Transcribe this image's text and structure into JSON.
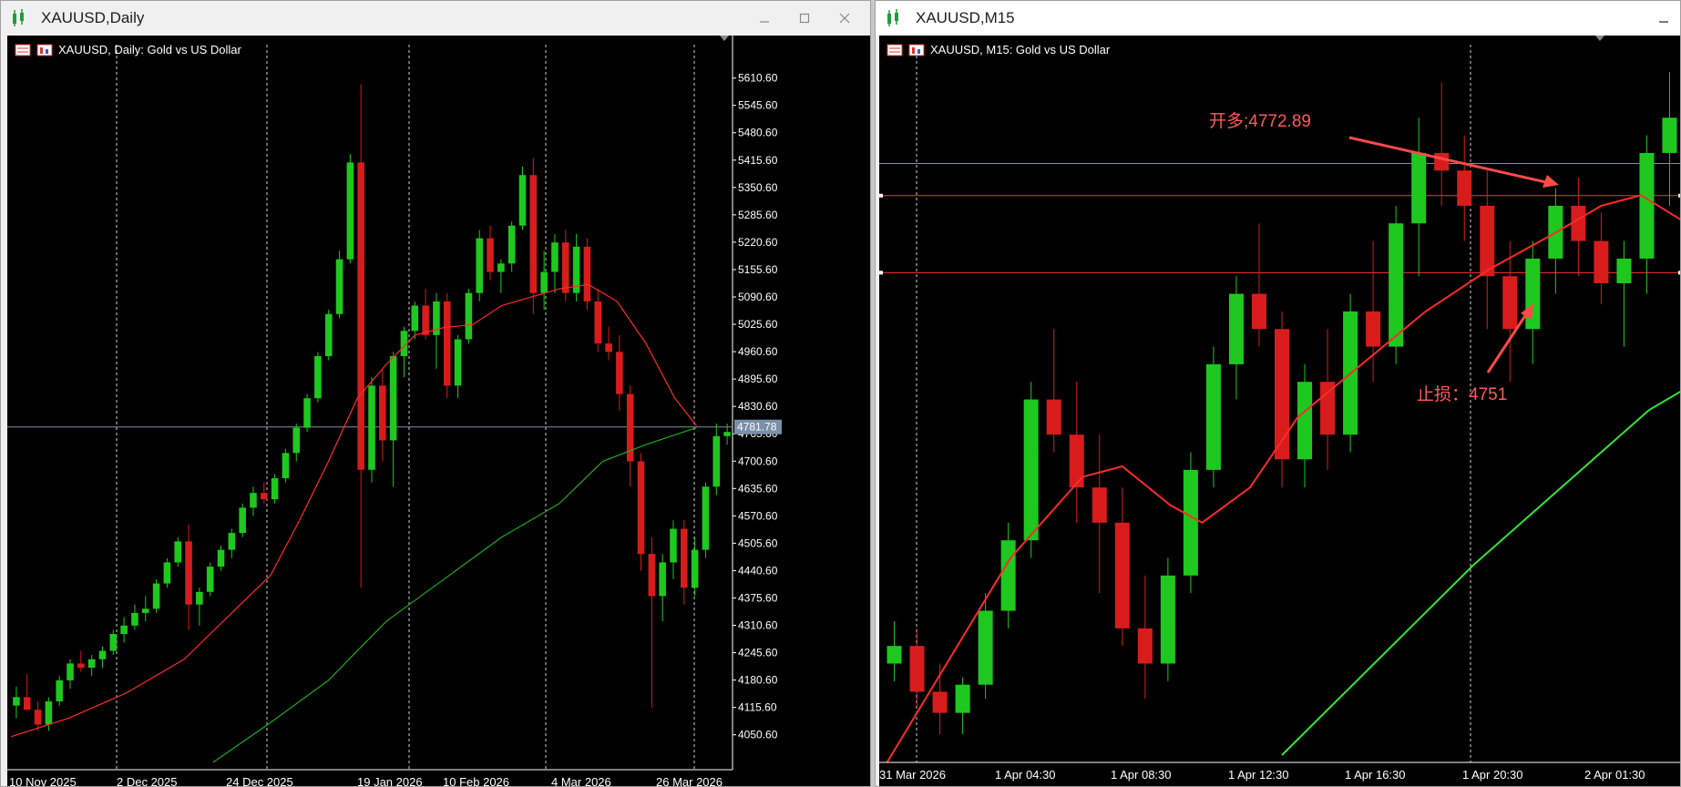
{
  "windows": [
    {
      "id": "daily",
      "title": "XAUUSD,Daily",
      "chart_header": "XAUUSD, Daily:  Gold vs US Dollar",
      "controls": [
        "minimize",
        "maximize",
        "close"
      ],
      "chart_data": {
        "type": "candlestick",
        "symbol": "XAUUSD",
        "timeframe": "Daily",
        "y_ticks": [
          "5610.60",
          "5545.60",
          "5480.60",
          "5415.60",
          "5350.60",
          "5285.60",
          "5220.60",
          "5155.60",
          "5090.60",
          "5025.60",
          "4960.60",
          "4895.60",
          "4830.60",
          "4765.60",
          "4700.60",
          "4635.60",
          "4570.60",
          "4505.60",
          "4440.60",
          "4375.60",
          "4310.60",
          "4245.60",
          "4180.60",
          "4115.60",
          "4050.60"
        ],
        "x_ticks": [
          "10 Nov 2025",
          "2 Dec 2025",
          "24 Dec 2025",
          "19 Jan 2026",
          "10 Feb 2026",
          "4 Mar 2026",
          "26 Mar 2026"
        ],
        "current_price": "4781.78",
        "ylim": [
          3985,
          5625
        ],
        "indicators": [
          {
            "name": "fast MA",
            "color": "#ff2a2a",
            "points": [
              [
                0,
                4046
              ],
              [
                8,
                4090
              ],
              [
                16,
                4150
              ],
              [
                24,
                4230
              ],
              [
                30,
                4330
              ],
              [
                36,
                4430
              ],
              [
                40,
                4560
              ],
              [
                44,
                4700
              ],
              [
                48,
                4850
              ],
              [
                52,
                4930
              ],
              [
                56,
                5000
              ],
              [
                60,
                5018
              ],
              [
                64,
                5025
              ],
              [
                68,
                5070
              ],
              [
                72,
                5090
              ],
              [
                76,
                5110
              ],
              [
                80,
                5120
              ],
              [
                84,
                5080
              ],
              [
                88,
                4980
              ],
              [
                92,
                4850
              ],
              [
                95,
                4785
              ]
            ]
          },
          {
            "name": "slow MA",
            "color": "#1eaa1e",
            "points": [
              [
                28,
                3985
              ],
              [
                36,
                4080
              ],
              [
                44,
                4180
              ],
              [
                52,
                4320
              ],
              [
                60,
                4420
              ],
              [
                68,
                4520
              ],
              [
                76,
                4600
              ],
              [
                82,
                4700
              ],
              [
                88,
                4740
              ],
              [
                95,
                4780
              ]
            ]
          }
        ],
        "candles": [
          [
            4120,
            4165,
            4090,
            4140
          ],
          [
            4140,
            4195,
            4110,
            4110
          ],
          [
            4110,
            4130,
            4060,
            4075
          ],
          [
            4075,
            4140,
            4060,
            4130
          ],
          [
            4130,
            4190,
            4120,
            4180
          ],
          [
            4180,
            4230,
            4160,
            4220
          ],
          [
            4220,
            4250,
            4200,
            4210
          ],
          [
            4210,
            4240,
            4190,
            4230
          ],
          [
            4230,
            4260,
            4210,
            4250
          ],
          [
            4250,
            4300,
            4240,
            4290
          ],
          [
            4290,
            4330,
            4270,
            4310
          ],
          [
            4310,
            4360,
            4300,
            4340
          ],
          [
            4340,
            4380,
            4320,
            4350
          ],
          [
            4350,
            4420,
            4340,
            4410
          ],
          [
            4410,
            4470,
            4400,
            4460
          ],
          [
            4460,
            4520,
            4450,
            4510
          ],
          [
            4510,
            4550,
            4300,
            4360
          ],
          [
            4360,
            4400,
            4310,
            4390
          ],
          [
            4390,
            4460,
            4380,
            4450
          ],
          [
            4450,
            4500,
            4440,
            4490
          ],
          [
            4490,
            4540,
            4470,
            4530
          ],
          [
            4530,
            4600,
            4520,
            4590
          ],
          [
            4590,
            4640,
            4570,
            4625
          ],
          [
            4625,
            4650,
            4600,
            4610
          ],
          [
            4610,
            4670,
            4600,
            4660
          ],
          [
            4660,
            4730,
            4650,
            4720
          ],
          [
            4720,
            4790,
            4700,
            4780
          ],
          [
            4780,
            4860,
            4770,
            4850
          ],
          [
            4850,
            4960,
            4840,
            4950
          ],
          [
            4950,
            5060,
            4940,
            5050
          ],
          [
            5050,
            5200,
            5040,
            5180
          ],
          [
            5180,
            5430,
            5170,
            5410
          ],
          [
            5410,
            5595,
            4400,
            4680
          ],
          [
            4680,
            4900,
            4650,
            4880
          ],
          [
            4880,
            4920,
            4700,
            4750
          ],
          [
            4750,
            4960,
            4640,
            4950
          ],
          [
            4950,
            5020,
            4900,
            5010
          ],
          [
            5010,
            5080,
            4990,
            5070
          ],
          [
            5070,
            5110,
            4990,
            5000
          ],
          [
            5000,
            5100,
            4920,
            5080
          ],
          [
            5080,
            5100,
            4850,
            4880
          ],
          [
            4880,
            5000,
            4850,
            4990
          ],
          [
            4990,
            5110,
            4980,
            5100
          ],
          [
            5100,
            5250,
            5080,
            5230
          ],
          [
            5230,
            5260,
            5130,
            5150
          ],
          [
            5150,
            5180,
            5100,
            5170
          ],
          [
            5170,
            5270,
            5150,
            5260
          ],
          [
            5260,
            5400,
            5250,
            5380
          ],
          [
            5380,
            5420,
            5050,
            5100
          ],
          [
            5100,
            5200,
            5060,
            5150
          ],
          [
            5150,
            5240,
            5100,
            5220
          ],
          [
            5220,
            5250,
            5080,
            5100
          ],
          [
            5100,
            5240,
            5080,
            5210
          ],
          [
            5210,
            5230,
            5060,
            5080
          ],
          [
            5080,
            5110,
            4960,
            4980
          ],
          [
            4980,
            5020,
            4940,
            4960
          ],
          [
            4960,
            5000,
            4820,
            4860
          ],
          [
            4860,
            4880,
            4640,
            4700
          ],
          [
            4700,
            4720,
            4440,
            4480
          ],
          [
            4480,
            4520,
            4115,
            4380
          ],
          [
            4380,
            4480,
            4320,
            4460
          ],
          [
            4460,
            4560,
            4420,
            4540
          ],
          [
            4540,
            4560,
            4360,
            4400
          ],
          [
            4400,
            4520,
            4380,
            4490
          ],
          [
            4490,
            4650,
            4470,
            4640
          ],
          [
            4640,
            4790,
            4620,
            4760
          ],
          [
            4760,
            4790,
            4740,
            4770
          ]
        ]
      }
    },
    {
      "id": "m15",
      "title": "XAUUSD,M15",
      "chart_header": "XAUUSD, M15:  Gold vs US Dollar",
      "controls": [
        "minimize"
      ],
      "chart_data": {
        "type": "candlestick",
        "symbol": "XAUUSD",
        "timeframe": "M15",
        "x_ticks": [
          "31 Mar 2026",
          "1 Apr 04:30",
          "1 Apr 08:30",
          "1 Apr 12:30",
          "1 Apr 16:30",
          "1 Apr 20:30",
          "2 Apr 01:30"
        ],
        "ylim": [
          4614,
          4808
        ],
        "horizontal_lines": [
          {
            "name": "entry-line",
            "price": 4772.89,
            "color": "#ff3030"
          },
          {
            "name": "stop-line",
            "price": 4751,
            "color": "#ff3030"
          },
          {
            "name": "current-price-line",
            "price": 4782,
            "color": "#7a8fa8"
          }
        ],
        "annotations": [
          {
            "name": "entry-annotation",
            "text": "开多;4772.89",
            "color": "#ff5a5a"
          },
          {
            "name": "stop-annotation",
            "text": "止损：4751",
            "color": "#ff5a5a"
          }
        ],
        "indicators": [
          {
            "name": "fast MA",
            "color": "#ff2a2a",
            "points": [
              [
                0,
                4610
              ],
              [
                8,
                4640
              ],
              [
                16,
                4670
              ],
              [
                25,
                4693
              ],
              [
                30,
                4696
              ],
              [
                36,
                4685
              ],
              [
                40,
                4680
              ],
              [
                46,
                4690
              ],
              [
                52,
                4710
              ],
              [
                60,
                4725
              ],
              [
                68,
                4740
              ],
              [
                76,
                4752
              ],
              [
                84,
                4762
              ],
              [
                90,
                4770
              ],
              [
                95,
                4773
              ],
              [
                100,
                4766
              ],
              [
                106,
                4770
              ]
            ]
          },
          {
            "name": "slow MA",
            "color": "#33e633",
            "points": [
              [
                50,
                4614
              ],
              [
                58,
                4632
              ],
              [
                66,
                4650
              ],
              [
                74,
                4668
              ],
              [
                82,
                4684
              ],
              [
                90,
                4700
              ],
              [
                96,
                4712
              ],
              [
                102,
                4720
              ],
              [
                106,
                4728
              ]
            ]
          }
        ],
        "candles": [
          [
            4640,
            4652,
            4635,
            4645
          ],
          [
            4645,
            4650,
            4628,
            4632
          ],
          [
            4632,
            4640,
            4620,
            4626
          ],
          [
            4626,
            4636,
            4620,
            4634
          ],
          [
            4634,
            4660,
            4630,
            4655
          ],
          [
            4655,
            4680,
            4650,
            4675
          ],
          [
            4675,
            4720,
            4670,
            4715
          ],
          [
            4715,
            4735,
            4700,
            4705
          ],
          [
            4705,
            4720,
            4680,
            4690
          ],
          [
            4690,
            4705,
            4660,
            4680
          ],
          [
            4680,
            4690,
            4645,
            4650
          ],
          [
            4650,
            4665,
            4630,
            4640
          ],
          [
            4640,
            4670,
            4635,
            4665
          ],
          [
            4665,
            4700,
            4660,
            4695
          ],
          [
            4695,
            4730,
            4690,
            4725
          ],
          [
            4725,
            4750,
            4715,
            4745
          ],
          [
            4745,
            4765,
            4730,
            4735
          ],
          [
            4735,
            4740,
            4690,
            4698
          ],
          [
            4698,
            4725,
            4690,
            4720
          ],
          [
            4720,
            4735,
            4695,
            4705
          ],
          [
            4705,
            4745,
            4700,
            4740
          ],
          [
            4740,
            4760,
            4720,
            4730
          ],
          [
            4730,
            4770,
            4725,
            4765
          ],
          [
            4765,
            4795,
            4750,
            4785
          ],
          [
            4785,
            4805,
            4770,
            4780
          ],
          [
            4780,
            4790,
            4760,
            4770
          ],
          [
            4770,
            4780,
            4735,
            4750
          ],
          [
            4750,
            4760,
            4720,
            4735
          ],
          [
            4735,
            4760,
            4725,
            4755
          ],
          [
            4755,
            4775,
            4745,
            4770
          ],
          [
            4770,
            4778,
            4750,
            4760
          ],
          [
            4760,
            4768,
            4742,
            4748
          ],
          [
            4748,
            4760,
            4730,
            4755
          ],
          [
            4755,
            4790,
            4745,
            4785
          ],
          [
            4785,
            4808,
            4770,
            4795
          ]
        ]
      }
    }
  ]
}
